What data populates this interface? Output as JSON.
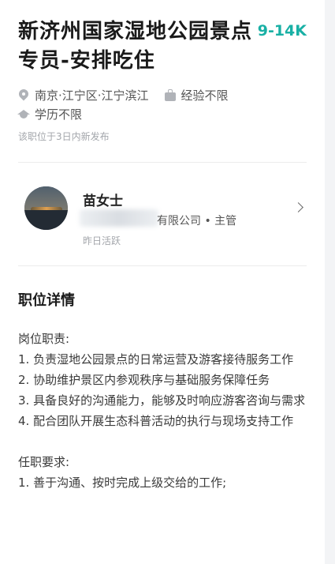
{
  "job": {
    "title": "新济州国家湿地公园景点专员-安排吃住",
    "salary": "9-14K",
    "location": "南京·江宁区·江宁滨江",
    "experience": "经验不限",
    "education": "学历不限",
    "posted": "该职位于3日内新发布"
  },
  "recruiter": {
    "name": "苗女士",
    "company_title": "有限公司 • 主管",
    "active": "昨日活跃"
  },
  "details": {
    "section_title": "职位详情",
    "duties_heading": "岗位职责:",
    "duties": [
      "1. 负责湿地公园景点的日常运营及游客接待服务工作",
      "2. 协助维护景区内参观秩序与基础服务保障任务",
      "3. 具备良好的沟通能力，能够及时响应游客咨询与需求",
      "4. 配合团队开展生态科普活动的执行与现场支持工作"
    ],
    "requirements_heading": "任职要求:",
    "requirements": [
      "1. 善于沟通、按时完成上级交给的工作;"
    ]
  },
  "icons": {
    "location": "pin-icon",
    "experience": "briefcase-icon",
    "education": "graduation-cap-icon",
    "more": "chevron-right-icon"
  },
  "colors": {
    "salary": "#19b0a5"
  }
}
